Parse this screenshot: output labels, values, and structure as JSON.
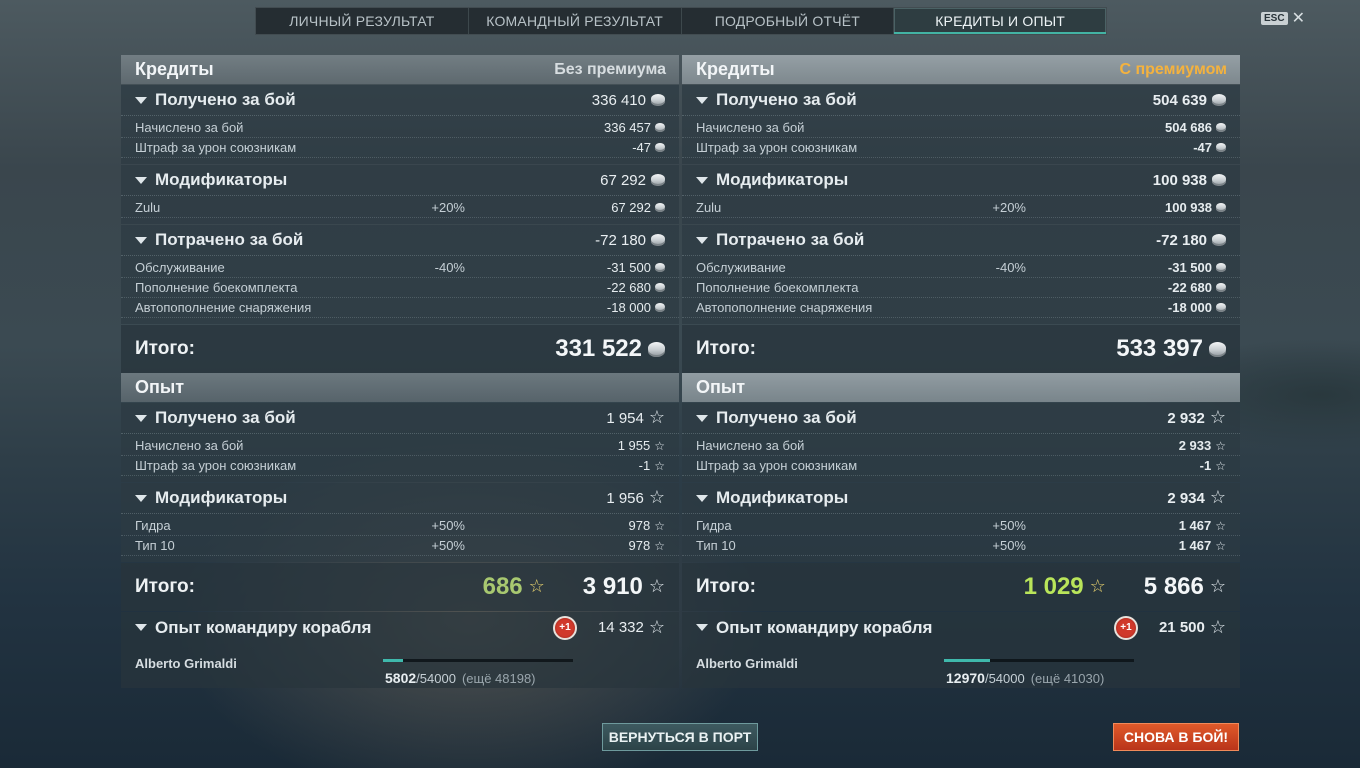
{
  "tabs": [
    {
      "label": "ЛИЧНЫЙ РЕЗУЛЬТАТ"
    },
    {
      "label": "КОМАНДНЫЙ РЕЗУЛЬТАТ"
    },
    {
      "label": "ПОДРОБНЫЙ ОТЧЁТ"
    },
    {
      "label": "КРЕДИТЫ И ОПЫТ",
      "active": true
    }
  ],
  "esc_label": "ESC",
  "left": {
    "credits_title": "Кредиты",
    "credits_mode": "Без премиума",
    "earned": {
      "label": "Получено за бой",
      "value": "336 410",
      "rows": [
        {
          "name": "Начислено за бой",
          "value": "336 457"
        },
        {
          "name": "Штраф за урон союзникам",
          "value": "-47"
        }
      ]
    },
    "mods": {
      "label": "Модификаторы",
      "value": "67 292",
      "rows": [
        {
          "name": "Zulu",
          "pct": "+20%",
          "value": "67 292"
        }
      ]
    },
    "spent": {
      "label": "Потрачено за бой",
      "value": "-72 180",
      "rows": [
        {
          "name": "Обслуживание",
          "pct": "-40%",
          "value": "-31 500"
        },
        {
          "name": "Пополнение боекомплекта",
          "value": "-22 680"
        },
        {
          "name": "Автопополнение снаряжения",
          "value": "-18 000"
        }
      ]
    },
    "credits_total_label": "Итого:",
    "credits_total": "331 522",
    "xp_title": "Опыт",
    "xp_earned": {
      "label": "Получено за бой",
      "value": "1 954",
      "rows": [
        {
          "name": "Начислено за бой",
          "value": "1 955"
        },
        {
          "name": "Штраф за урон союзникам",
          "value": "-1"
        }
      ]
    },
    "xp_mods": {
      "label": "Модификаторы",
      "value": "1 956",
      "rows": [
        {
          "name": "Гидра",
          "pct": "+50%",
          "value": "978"
        },
        {
          "name": "Тип 10",
          "pct": "+50%",
          "value": "978"
        }
      ]
    },
    "xp_total_label": "Итого:",
    "xp_free": "686",
    "xp_total": "3 910",
    "cmd": {
      "label": "Опыт командиру корабля",
      "badge": "+1",
      "value": "14 332",
      "name": "Alberto Grimaldi",
      "progress": 5802,
      "max": "54000",
      "current": "5802",
      "rest": "(ещё 48198)",
      "fraction": 0.107
    }
  },
  "right": {
    "credits_title": "Кредиты",
    "credits_mode": "С премиумом",
    "earned": {
      "label": "Получено за бой",
      "value": "504 639",
      "rows": [
        {
          "name": "Начислено за бой",
          "value": "504 686"
        },
        {
          "name": "Штраф за урон союзникам",
          "value": "-47"
        }
      ]
    },
    "mods": {
      "label": "Модификаторы",
      "value": "100 938",
      "rows": [
        {
          "name": "Zulu",
          "pct": "+20%",
          "value": "100 938"
        }
      ]
    },
    "spent": {
      "label": "Потрачено за бой",
      "value": "-72 180",
      "rows": [
        {
          "name": "Обслуживание",
          "pct": "-40%",
          "value": "-31 500"
        },
        {
          "name": "Пополнение боекомплекта",
          "value": "-22 680"
        },
        {
          "name": "Автопополнение снаряжения",
          "value": "-18 000"
        }
      ]
    },
    "credits_total_label": "Итого:",
    "credits_total": "533 397",
    "xp_title": "Опыт",
    "xp_earned": {
      "label": "Получено за бой",
      "value": "2 932",
      "rows": [
        {
          "name": "Начислено за бой",
          "value": "2 933"
        },
        {
          "name": "Штраф за урон союзникам",
          "value": "-1"
        }
      ]
    },
    "xp_mods": {
      "label": "Модификаторы",
      "value": "2 934",
      "rows": [
        {
          "name": "Гидра",
          "pct": "+50%",
          "value": "1 467"
        },
        {
          "name": "Тип 10",
          "pct": "+50%",
          "value": "1 467"
        }
      ]
    },
    "xp_total_label": "Итого:",
    "xp_free": "1 029",
    "xp_total": "5 866",
    "cmd": {
      "label": "Опыт командиру корабля",
      "badge": "+1",
      "value": "21 500",
      "name": "Alberto Grimaldi",
      "max": "54000",
      "current": "12970",
      "rest": "(ещё 41030)",
      "fraction": 0.24
    }
  },
  "buttons": {
    "port": "ВЕРНУТЬСЯ В ПОРТ",
    "battle": "СНОВА В БОЙ!"
  },
  "colors": {
    "premium": "#f4b23e",
    "accent": "#3fb9ac",
    "battle": "#d2441f",
    "free_xp": "#b9e55a"
  }
}
